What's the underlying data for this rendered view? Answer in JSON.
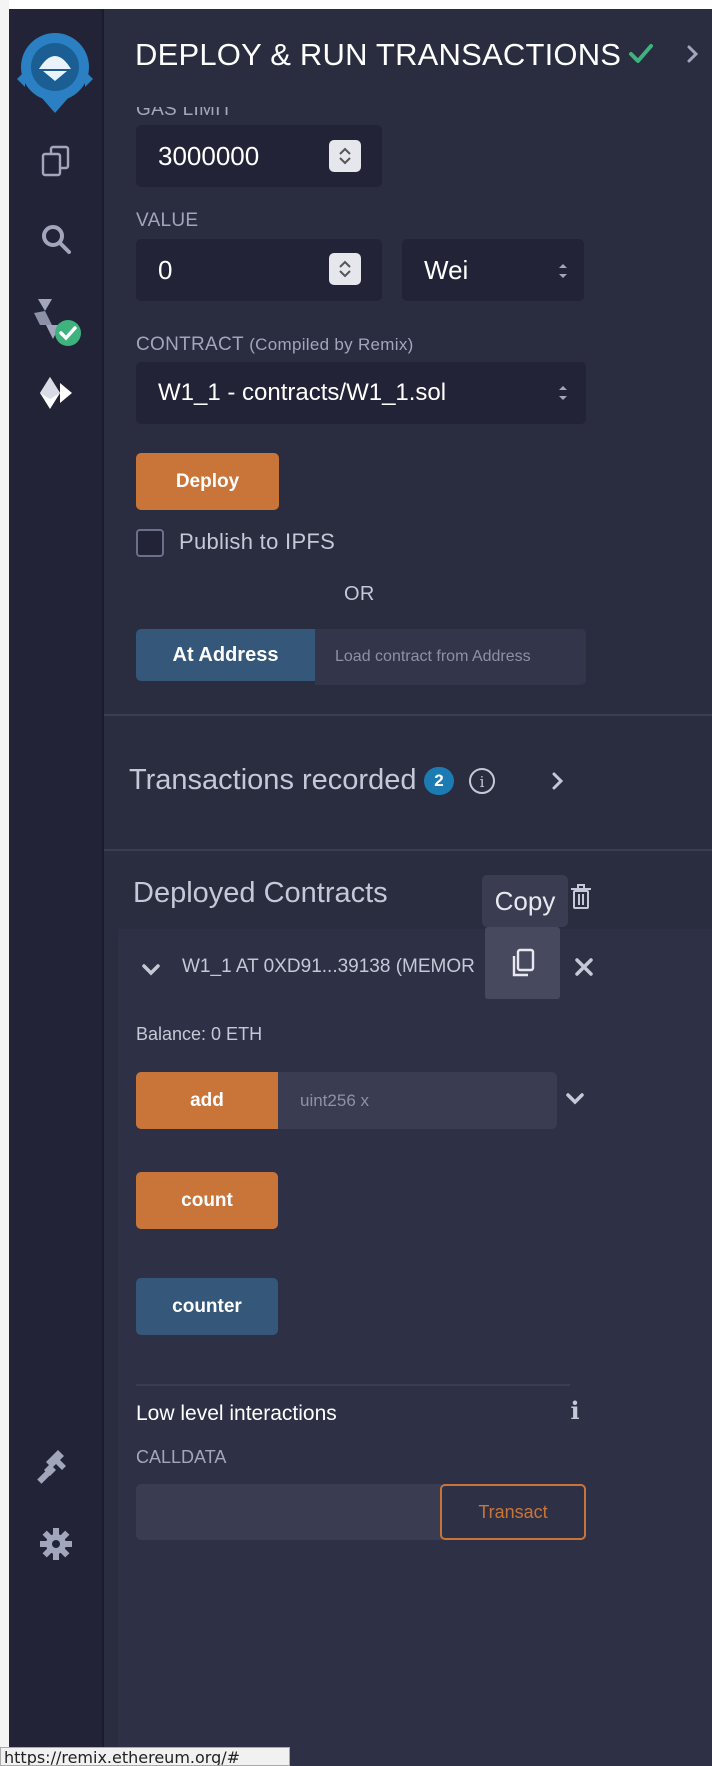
{
  "header": {
    "title": "DEPLOY & RUN TRANSACTIONS"
  },
  "sidebar": {
    "icons": [
      "remix-logo-icon",
      "file-explorer-icon",
      "search-icon",
      "solidity-compiler-icon",
      "deploy-run-icon",
      "plugin-manager-icon",
      "settings-icon"
    ]
  },
  "form": {
    "gas_limit_label": "GAS LIMIT",
    "gas_limit_value": "3000000",
    "value_label": "VALUE",
    "value_amount": "0",
    "value_unit": "Wei",
    "contract_label": "CONTRACT",
    "contract_label_note": "(Compiled by Remix)",
    "contract_selected": "W1_1 - contracts/W1_1.sol",
    "deploy_label": "Deploy",
    "publish_label": "Publish to IPFS",
    "or_label": "OR",
    "at_address_label": "At Address",
    "at_address_placeholder": "Load contract from Address"
  },
  "transactions": {
    "title": "Transactions recorded",
    "count": "2"
  },
  "deployed": {
    "title": "Deployed Contracts",
    "tooltip": "Copy",
    "instance_label": "W1_1 AT 0XD91...39138 (MEMOR",
    "balance": "Balance: 0 ETH",
    "functions": [
      {
        "label": "add",
        "placeholder": "uint256 x"
      },
      {
        "label": "count"
      },
      {
        "label": "counter"
      }
    ],
    "low_level_title": "Low level interactions",
    "calldata_label": "CALLDATA",
    "transact_label": "Transact"
  },
  "colors": {
    "accent_orange": "#c97539",
    "accent_blue": "#35587a",
    "success_green": "#3eb37d",
    "badge_blue": "#1d7bb3"
  },
  "status_bar": {
    "url": "https://remix.ethereum.org/#"
  }
}
